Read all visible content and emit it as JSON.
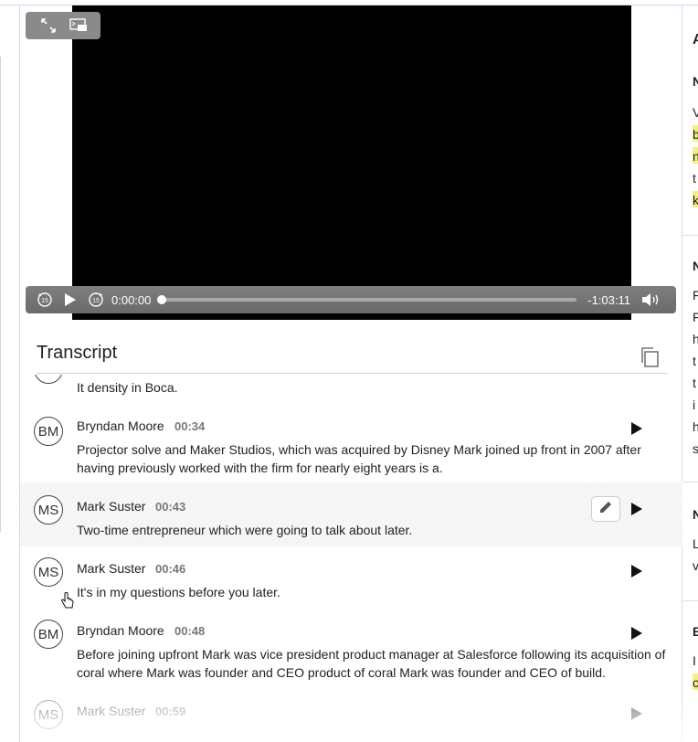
{
  "player": {
    "current_time": "0:00:00",
    "remaining_time": "-1:03:11",
    "progress_fraction": 0.0,
    "icons": [
      "expand-icon",
      "picture-in-picture-icon",
      "rewind-15-icon",
      "play-icon",
      "forward-15-icon",
      "volume-icon"
    ]
  },
  "transcript": {
    "title": "Transcript",
    "entries": [
      {
        "text": "It density in Boca."
      },
      {
        "initials": "BM",
        "speaker": "Bryndan Moore",
        "time": "00:34",
        "text": "Projector solve and Maker Studios, which was acquired by Disney Mark joined up front in 2007 after having previously worked with the firm for nearly eight years is a."
      },
      {
        "initials": "MS",
        "speaker": "Mark Suster",
        "time": "00:43",
        "text": "Two-time entrepreneur which were going to talk about later."
      },
      {
        "initials": "MS",
        "speaker": "Mark Suster",
        "time": "00:46",
        "text": "It's in my questions before you later."
      },
      {
        "initials": "BM",
        "speaker": "Bryndan Moore",
        "time": "00:48",
        "text": "Before joining upfront Mark was vice president product manager at Salesforce following its acquisition of coral where Mark was founder and CEO product of coral Mark was founder and CEO of build."
      },
      {
        "initials": "MS",
        "speaker": "Mark Suster",
        "time": "00:59"
      }
    ]
  },
  "right_panel": {
    "glyphs": [
      "A",
      "N",
      "V",
      "b",
      "n",
      "t",
      "k",
      "N",
      "F",
      "F",
      "h",
      "t",
      "t",
      "i",
      "h",
      "s",
      "N",
      "L",
      "v",
      "E",
      "I",
      "c"
    ]
  },
  "colors": {
    "highlight": "#f2f27a",
    "border": "#d9d6ee",
    "video_bg": "#000000",
    "controls_bg": "#7a7a7a"
  }
}
